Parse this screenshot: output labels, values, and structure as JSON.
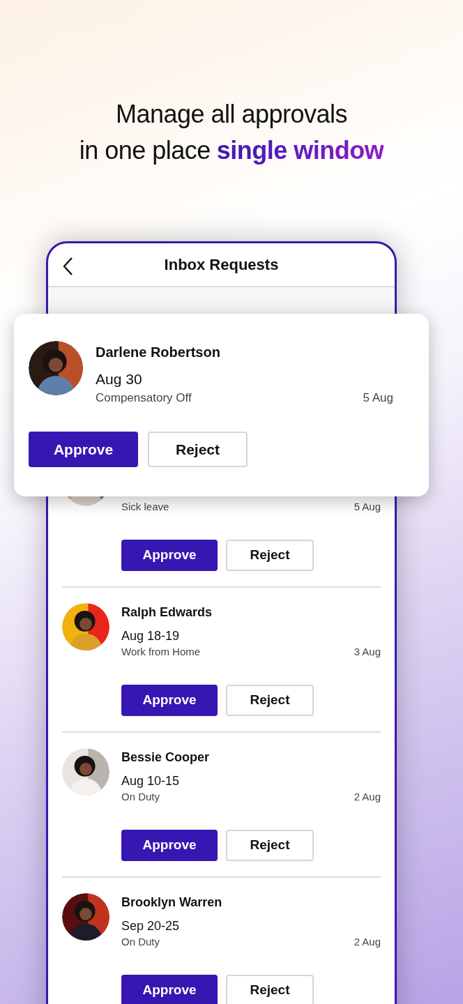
{
  "headline": {
    "line_1": "Manage all approvals",
    "line_2": "in one place",
    "highlight": "single window"
  },
  "screen": {
    "title": "Inbox Requests"
  },
  "featured_request": {
    "name": "Darlene Robertson",
    "dates": "Aug 30",
    "type": "Compensatory Off",
    "received": "5 Aug",
    "approve": "Approve",
    "reject": "Reject"
  },
  "requests": [
    {
      "type": "Sick leave",
      "received": "5 Aug",
      "approve": "Approve",
      "reject": "Reject"
    },
    {
      "name": "Ralph Edwards",
      "dates": "Aug 18-19",
      "type": "Work from Home",
      "received": "3 Aug",
      "approve": "Approve",
      "reject": "Reject"
    },
    {
      "name": "Bessie Cooper",
      "dates": "Aug 10-15",
      "type": "On Duty",
      "received": "2 Aug",
      "approve": "Approve",
      "reject": "Reject"
    },
    {
      "name": "Brooklyn Warren",
      "dates": "Sep 20-25",
      "type": "On Duty",
      "received": "2 Aug",
      "approve": "Approve",
      "reject": "Reject"
    }
  ]
}
